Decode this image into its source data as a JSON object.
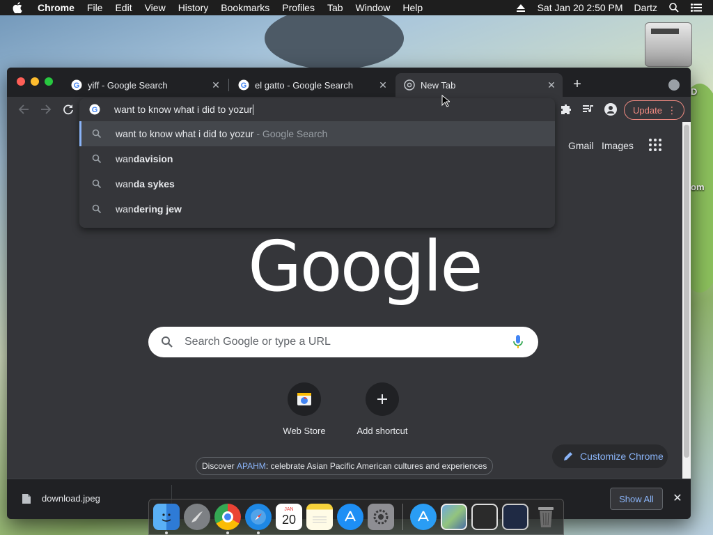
{
  "menubar": {
    "app_name": "Chrome",
    "items": [
      "File",
      "Edit",
      "View",
      "History",
      "Bookmarks",
      "Profiles",
      "Tab",
      "Window",
      "Help"
    ],
    "datetime": "Sat Jan 20  2:50 PM",
    "user": "Dartz"
  },
  "desktop": {
    "partial_text_1": "D",
    "partial_text_2": "om"
  },
  "tabs": [
    {
      "title": "yiff - Google Search",
      "active": false
    },
    {
      "title": "el gatto - Google Search",
      "active": false
    },
    {
      "title": "New Tab",
      "active": true
    }
  ],
  "toolbar": {
    "update_label": "Update"
  },
  "omnibox": {
    "value": "want to know what i did to yozur",
    "suggestions": [
      {
        "prefix": "want to know what i did to yozur",
        "bold": "",
        "suffix": " - Google Search",
        "selected": true
      },
      {
        "prefix": "wan",
        "bold": "davision",
        "suffix": "",
        "selected": false
      },
      {
        "prefix": "wan",
        "bold": "da sykes",
        "suffix": "",
        "selected": false
      },
      {
        "prefix": "wan",
        "bold": "dering jew",
        "suffix": "",
        "selected": false
      }
    ]
  },
  "ntp": {
    "gmail_label": "Gmail",
    "images_label": "Images",
    "logo_text": "Google",
    "search_placeholder": "Search Google or type a URL",
    "shortcuts": [
      {
        "label": "Web Store"
      },
      {
        "label": "Add shortcut"
      }
    ],
    "promo": {
      "before": "Discover ",
      "link": "APAHM",
      "after": ": celebrate Asian Pacific American cultures and experiences"
    },
    "customize_label": "Customize Chrome"
  },
  "downloads": {
    "file_name": "download.jpeg",
    "show_all_label": "Show All"
  },
  "dock": {
    "calendar_month": "JAN",
    "calendar_day": "20"
  },
  "colors": {
    "accent_blue": "#8ab4f8",
    "update_red": "#f28b82",
    "chrome_dark": "#35363a",
    "tabstrip_dark": "#202124"
  }
}
